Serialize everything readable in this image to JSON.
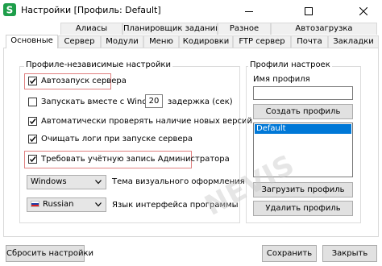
{
  "window": {
    "title": "Настройки [Профиль: Default]",
    "app_icon": "green-s-icon",
    "controls": [
      "minimize-icon",
      "maximize-icon",
      "close-icon"
    ]
  },
  "tabs_row1": [
    {
      "label": "Алиасы"
    },
    {
      "label": "Планировщик заданий"
    },
    {
      "label": "Разное"
    },
    {
      "label": "Автозагрузка"
    }
  ],
  "tabs_row2": [
    {
      "label": "Основные",
      "active": true
    },
    {
      "label": "Сервер"
    },
    {
      "label": "Модули"
    },
    {
      "label": "Меню"
    },
    {
      "label": "Кодировки"
    },
    {
      "label": "FTP сервер"
    },
    {
      "label": "Почта"
    },
    {
      "label": "Закладки"
    }
  ],
  "independent": {
    "title": "Профиле-независимые настройки",
    "autostart": {
      "label": "Автозапуск сервера",
      "checked": true
    },
    "start_with_windows": {
      "label": "Запускать вместе с Windows",
      "checked": false,
      "delay_value": "20",
      "delay_label": "задержка (сек)"
    },
    "check_updates": {
      "label": "Автоматически проверять наличие новых версий",
      "checked": true
    },
    "clear_logs": {
      "label": "Очищать логи при запуске сервера",
      "checked": true
    },
    "require_admin": {
      "label": "Требовать учётную запись Администратора",
      "checked": true
    },
    "theme": {
      "value": "Windows",
      "label": "Тема визуального оформления"
    },
    "language": {
      "value": "Russian",
      "label": "Язык интерфейса программы"
    }
  },
  "profiles": {
    "title": "Профили настроек",
    "name_label": "Имя профиля",
    "name_value": "",
    "create_button": "Создать профиль",
    "list": [
      "Default"
    ],
    "load_button": "Загрузить профиль",
    "delete_button": "Удалить профиль"
  },
  "footer": {
    "reset_button": "Сбросить настройки",
    "save_button": "Сохранить",
    "close_button": "Закрыть"
  },
  "watermark": "NEVIS",
  "colors": {
    "highlight": "#e08080",
    "selection": "#0078d7",
    "app_icon_green": "#1e9e4a"
  }
}
